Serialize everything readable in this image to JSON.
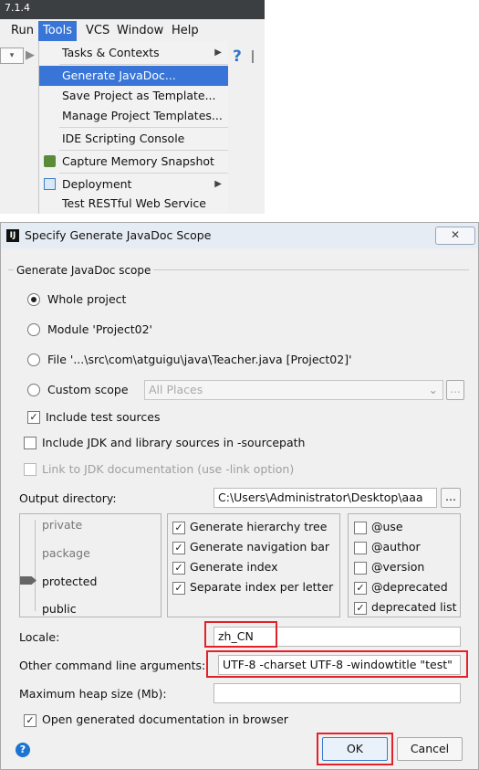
{
  "ide": {
    "version": "7.1.4",
    "menubar": [
      "Run",
      "Tools",
      "VCS",
      "Window",
      "Help"
    ],
    "tools_menu": [
      {
        "label": "Tasks & Contexts",
        "submenu": true
      },
      {
        "label": "Generate JavaDoc...",
        "selected": true
      },
      {
        "label": "Save Project as Template..."
      },
      {
        "label": "Manage Project Templates..."
      },
      {
        "label": "IDE Scripting Console"
      },
      {
        "label": "Capture Memory Snapshot"
      },
      {
        "label": "Deployment",
        "submenu": true
      },
      {
        "label": "Test RESTful Web Service"
      }
    ]
  },
  "dialog": {
    "title": "Specify Generate JavaDoc Scope",
    "close_icon": "close-icon",
    "scope_group_title": "Generate JavaDoc scope",
    "scope_options": [
      {
        "label": "Whole project",
        "checked": true
      },
      {
        "label": "Module 'Project02'"
      },
      {
        "label": "File '...\\src\\com\\atguigu\\java\\Teacher.java [Project02]'"
      },
      {
        "label": "Custom scope"
      }
    ],
    "custom_scope_value": "All Places",
    "custom_scope_browse": "...",
    "include_test_sources": {
      "label": "Include test sources",
      "checked": true
    },
    "include_jdk": {
      "label": "Include JDK and library sources in -sourcepath",
      "checked": false
    },
    "link_jdk": {
      "label": "Link to JDK documentation (use -link option)",
      "checked": false,
      "disabled": true
    },
    "output_dir_label": "Output directory:",
    "output_dir_value": "C:\\Users\\Administrator\\Desktop\\aaa",
    "output_dir_browse": "...",
    "visibility_levels": [
      "private",
      "package",
      "protected",
      "public"
    ],
    "visibility_selected": "protected",
    "generate_options": [
      {
        "label": "Generate hierarchy tree",
        "checked": true
      },
      {
        "label": "Generate navigation bar",
        "checked": true
      },
      {
        "label": "Generate index",
        "checked": true
      },
      {
        "label": "Separate index per letter",
        "checked": true
      }
    ],
    "tag_options": [
      {
        "label": "@use",
        "checked": false
      },
      {
        "label": "@author",
        "checked": false
      },
      {
        "label": "@version",
        "checked": false
      },
      {
        "label": "@deprecated",
        "checked": true
      },
      {
        "label": "deprecated list",
        "checked": true
      }
    ],
    "locale_label": "Locale:",
    "locale_value": "zh_CN",
    "other_args_label": "Other command line arguments:",
    "other_args_value": "UTF-8 -charset UTF-8 -windowtitle \"test\"",
    "max_heap_label": "Maximum heap size (Mb):",
    "max_heap_value": "",
    "open_browser": {
      "label": "Open generated documentation in browser",
      "checked": true
    },
    "ok_label": "OK",
    "cancel_label": "Cancel",
    "help_icon": "help-icon",
    "accent_color": "#3875d7",
    "highlight_color": "#e2222a"
  }
}
